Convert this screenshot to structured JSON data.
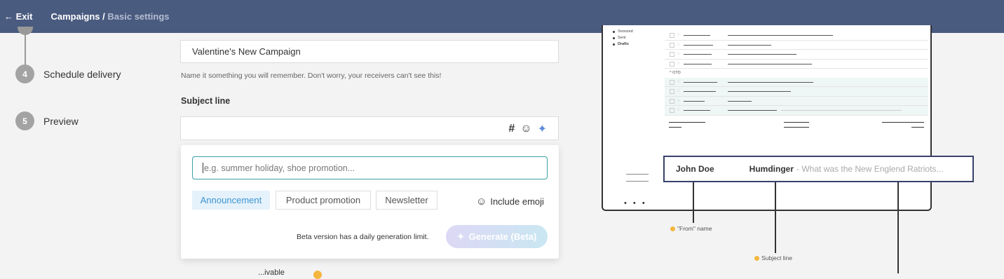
{
  "topbar": {
    "exit": "← Exit",
    "crumb_main": "Campaigns",
    "crumb_sep": " / ",
    "crumb_sub": "Basic settings"
  },
  "steps": [
    {
      "num": "4",
      "label": "Schedule delivery"
    },
    {
      "num": "5",
      "label": "Preview"
    }
  ],
  "form": {
    "name_value": "Valentine's New Campaign",
    "name_hint": "Name it something you will remember. Don't worry, your receivers can't see this!",
    "subject_label": "Subject line",
    "hash_icon": "#",
    "emoji_icon": "☺",
    "sparkle_icon": "✦"
  },
  "ai_popup": {
    "placeholder": "e.g. summer holiday, shoe promotion...",
    "chips": [
      "Announcement",
      "Product promotion",
      "Newsletter"
    ],
    "include_emoji": "Include emoji",
    "beta_note": "Beta version has a daily generation limit.",
    "generate": "Generate (Beta)"
  },
  "below": {
    "fragment": "...ivable"
  },
  "preview": {
    "nav": [
      "Snoozed",
      "Sent",
      "Drafts"
    ],
    "section": "^ OTD",
    "dots": "• • •",
    "from_name": "John Doe",
    "subject": "Humdinger",
    "preview_text": "- What was the New Englend Ratriots...",
    "callout_from": "\"From\" name",
    "callout_subject": "Subject line"
  },
  "colors": {
    "topbar": "#4a5b80",
    "accent": "#3b9fa4",
    "chip_active": "#3d96d0",
    "callout_dot": "#f3b63f"
  }
}
